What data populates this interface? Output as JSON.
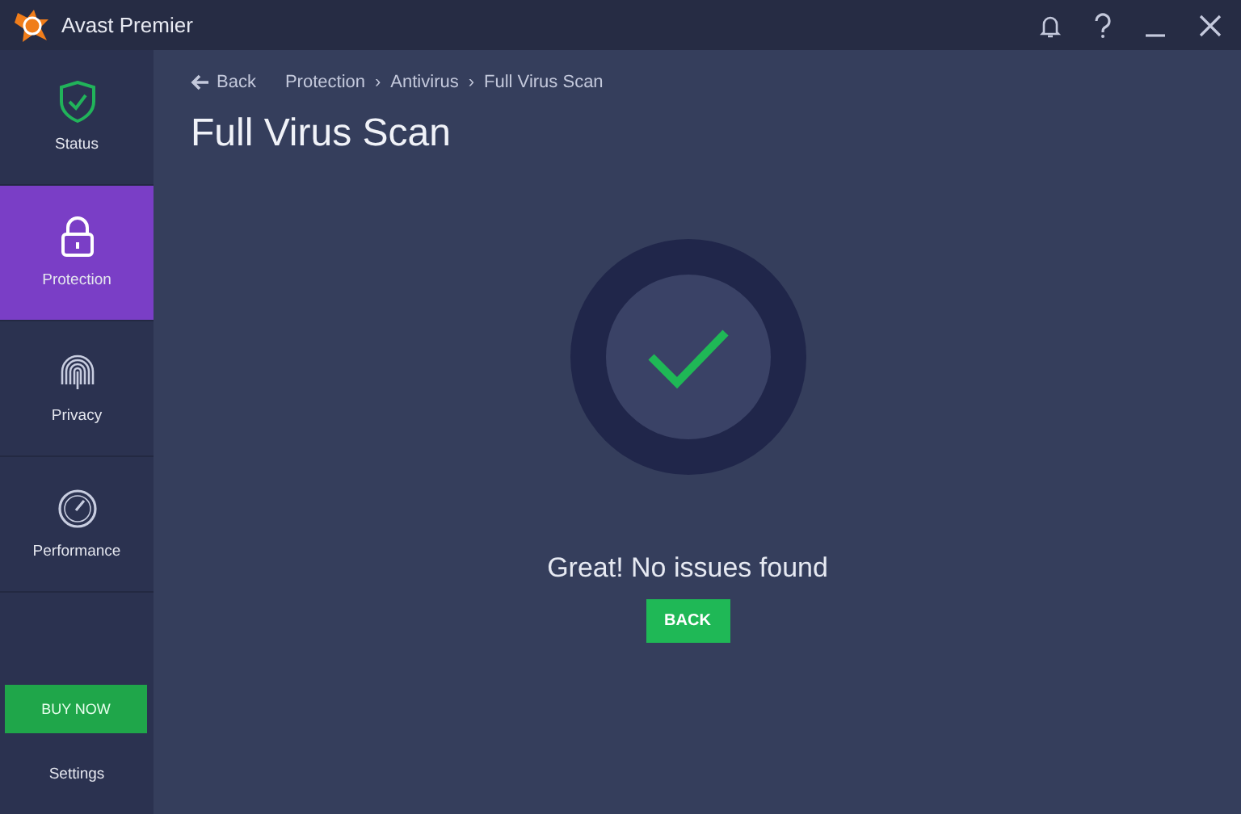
{
  "window": {
    "title": "Avast Premier"
  },
  "sidebar": {
    "items": [
      {
        "kind": "shield",
        "label": "Status",
        "selected": false
      },
      {
        "kind": "lock",
        "label": "Protection",
        "selected": true
      },
      {
        "kind": "fingerprint",
        "label": "Privacy",
        "selected": false
      },
      {
        "kind": "gauge",
        "label": "Performance",
        "selected": false
      }
    ],
    "buy_button": "BUY NOW",
    "settings": "Settings"
  },
  "breadcrumb": {
    "back": "Back",
    "path": [
      "Protection",
      "Antivirus",
      "Full Virus Scan"
    ],
    "separator": "›"
  },
  "page_title": "Full Virus Scan",
  "result": {
    "message": "Great! No issues found",
    "button": "BACK"
  }
}
